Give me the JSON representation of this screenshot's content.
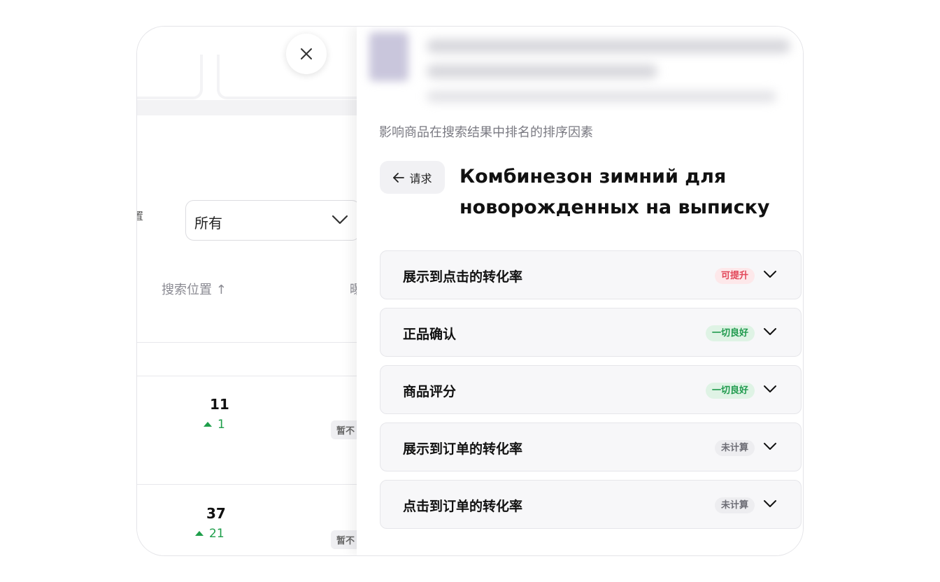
{
  "background": {
    "field_label": "置",
    "select_value": "所有",
    "col_header_1": "搜索位置 ↑",
    "col_header_2": "曝",
    "rows": [
      {
        "position": "11",
        "delta": "1",
        "chip": "暂不"
      },
      {
        "position": "37",
        "delta": "21",
        "chip": "暂不"
      }
    ],
    "colors": {
      "delta_green": "#1e9e4a"
    }
  },
  "panel": {
    "subtitle": "影响商品在搜索结果中排名的排序因素",
    "back_label": "请求",
    "title": "Комбинезон зимний для новорожденных на выписку",
    "factors": [
      {
        "label": "展示到点击的转化率",
        "status": "可提升",
        "status_color": "red"
      },
      {
        "label": "正品确认",
        "status": "一切良好",
        "status_color": "green"
      },
      {
        "label": "商品评分",
        "status": "一切良好",
        "status_color": "green"
      },
      {
        "label": "展示到订单的转化率",
        "status": "未计算",
        "status_color": "gray"
      },
      {
        "label": "点击到订单的转化率",
        "status": "未计算",
        "status_color": "gray"
      }
    ]
  },
  "icons": {
    "close": "close-icon",
    "back": "arrow-left-icon",
    "expand": "chevron-down-icon"
  }
}
